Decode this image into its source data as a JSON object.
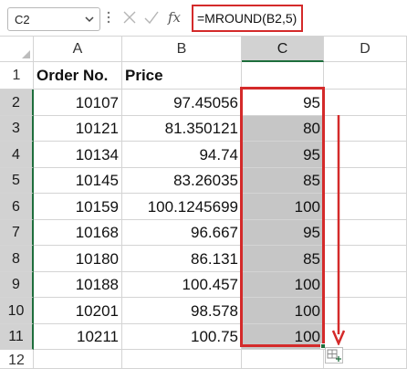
{
  "name_box": "C2",
  "formula": "=MROUND(B2,5)",
  "columns": [
    "A",
    "B",
    "C",
    "D"
  ],
  "rows": [
    "1",
    "2",
    "3",
    "4",
    "5",
    "6",
    "7",
    "8",
    "9",
    "10",
    "11",
    "12"
  ],
  "header": {
    "a": "Order No.",
    "b": "Price",
    "c": ""
  },
  "data": [
    {
      "a": "10107",
      "b": "97.45056",
      "c": "95"
    },
    {
      "a": "10121",
      "b": "81.350121",
      "c": "80"
    },
    {
      "a": "10134",
      "b": "94.74",
      "c": "95"
    },
    {
      "a": "10145",
      "b": "83.26035",
      "c": "85"
    },
    {
      "a": "10159",
      "b": "100.1245699",
      "c": "100"
    },
    {
      "a": "10168",
      "b": "96.667",
      "c": "95"
    },
    {
      "a": "10180",
      "b": "86.131",
      "c": "85"
    },
    {
      "a": "10188",
      "b": "100.457",
      "c": "100"
    },
    {
      "a": "10201",
      "b": "98.578",
      "c": "100"
    },
    {
      "a": "10211",
      "b": "100.75",
      "c": "100"
    }
  ],
  "icons": {
    "name_box_dropdown": "chevron-down-icon",
    "more": "more-vertical-icon",
    "cancel": "cancel-x-icon",
    "enter": "check-icon",
    "insert_function": "fx-icon",
    "select_all": "select-all-corner-icon",
    "fill_direction": "arrow-down-icon",
    "autofill_options": "auto-fill-options-icon"
  },
  "colors": {
    "highlight": "#d42a2a",
    "selection_fill": "#c6c6c6",
    "excel_green": "#1e6e3c"
  }
}
